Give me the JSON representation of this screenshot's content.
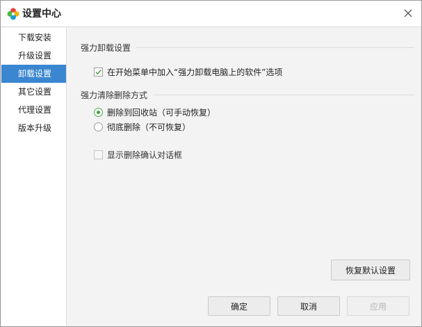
{
  "window": {
    "title": "设置中心",
    "icons": {
      "app": "clover-logo-icon",
      "close": "close-icon"
    }
  },
  "sidebar": {
    "items": [
      {
        "label": "下载安装",
        "active": false
      },
      {
        "label": "升级设置",
        "active": false
      },
      {
        "label": "卸载设置",
        "active": true
      },
      {
        "label": "其它设置",
        "active": false
      },
      {
        "label": "代理设置",
        "active": false
      },
      {
        "label": "版本升级",
        "active": false
      }
    ]
  },
  "main": {
    "section_force_uninstall": {
      "title": "强力卸载设置",
      "start_menu_option": {
        "label": "在开始菜单中加入“强力卸载电脑上的软件”选项",
        "checked": true
      }
    },
    "section_delete_mode": {
      "title": "强力清除删除方式",
      "options": [
        {
          "label": "删除到回收站（可手动恢复）",
          "selected": true
        },
        {
          "label": "彻底删除（不可恢复）",
          "selected": false
        }
      ],
      "confirm_dialog_option": {
        "label": "显示删除确认对话框",
        "checked": false
      }
    },
    "restore_defaults_label": "恢复默认设置"
  },
  "footer": {
    "ok_label": "确定",
    "cancel_label": "取消",
    "apply_label": "应用"
  },
  "colors": {
    "accent": "#3a86d1",
    "check_green": "#3ea43e"
  }
}
